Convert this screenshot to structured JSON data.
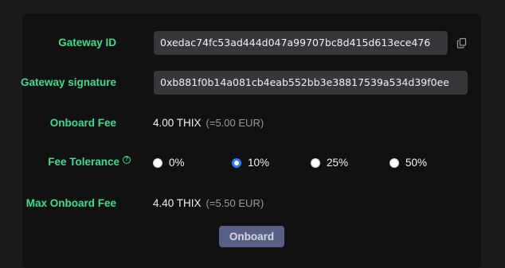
{
  "gateway_id": {
    "label": "Gateway ID",
    "value": "0xedac74fc53ad444d047a99707bc8d415d613ece476",
    "copy_icon": "copy-icon"
  },
  "gateway_signature": {
    "label": "Gateway signature",
    "value": "0xb881f0b14a081cb4eab552bb3e38817539a534d39f0ee"
  },
  "onboard_fee": {
    "label": "Onboard Fee",
    "amount": "4.00 THIX",
    "fiat": "(=5.00 EUR)"
  },
  "fee_tolerance": {
    "label": "Fee Tolerance",
    "help_icon": "?",
    "options": [
      "0%",
      "10%",
      "25%",
      "50%"
    ],
    "selected": "10%"
  },
  "max_onboard_fee": {
    "label": "Max Onboard Fee",
    "amount": "4.40 THIX",
    "fiat": "(=5.50 EUR)"
  },
  "onboard_button": {
    "label": "Onboard"
  },
  "colors": {
    "accent": "#3ddc91",
    "radio_selected": "#2f7bf5",
    "button_bg": "#5a5f85"
  }
}
